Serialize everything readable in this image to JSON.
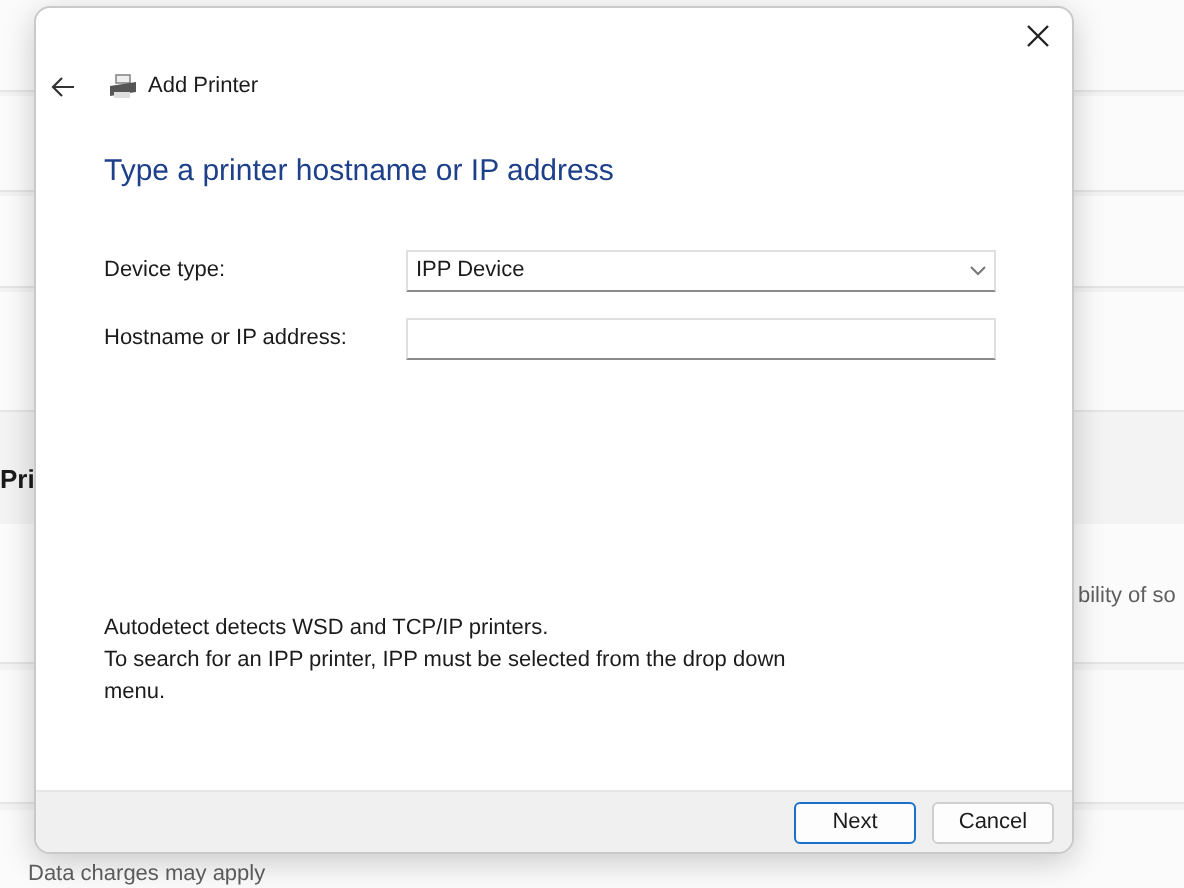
{
  "background": {
    "section_heading": "Pri",
    "description": "bility of so",
    "footer_note": "Data charges may apply"
  },
  "dialog": {
    "title": "Add Printer",
    "heading": "Type a printer hostname or IP address",
    "fields": [
      {
        "kind": "select",
        "label": "Device type:",
        "value": "IPP Device"
      },
      {
        "kind": "text",
        "label": "Hostname or IP address:"
      }
    ],
    "info": [
      "Autodetect detects WSD and TCP/IP printers.",
      "To search for an IPP printer, IPP must be selected from the drop down menu."
    ],
    "buttons": [
      {
        "label": "Next",
        "default": true
      },
      {
        "label": "Cancel",
        "default": false
      }
    ]
  }
}
